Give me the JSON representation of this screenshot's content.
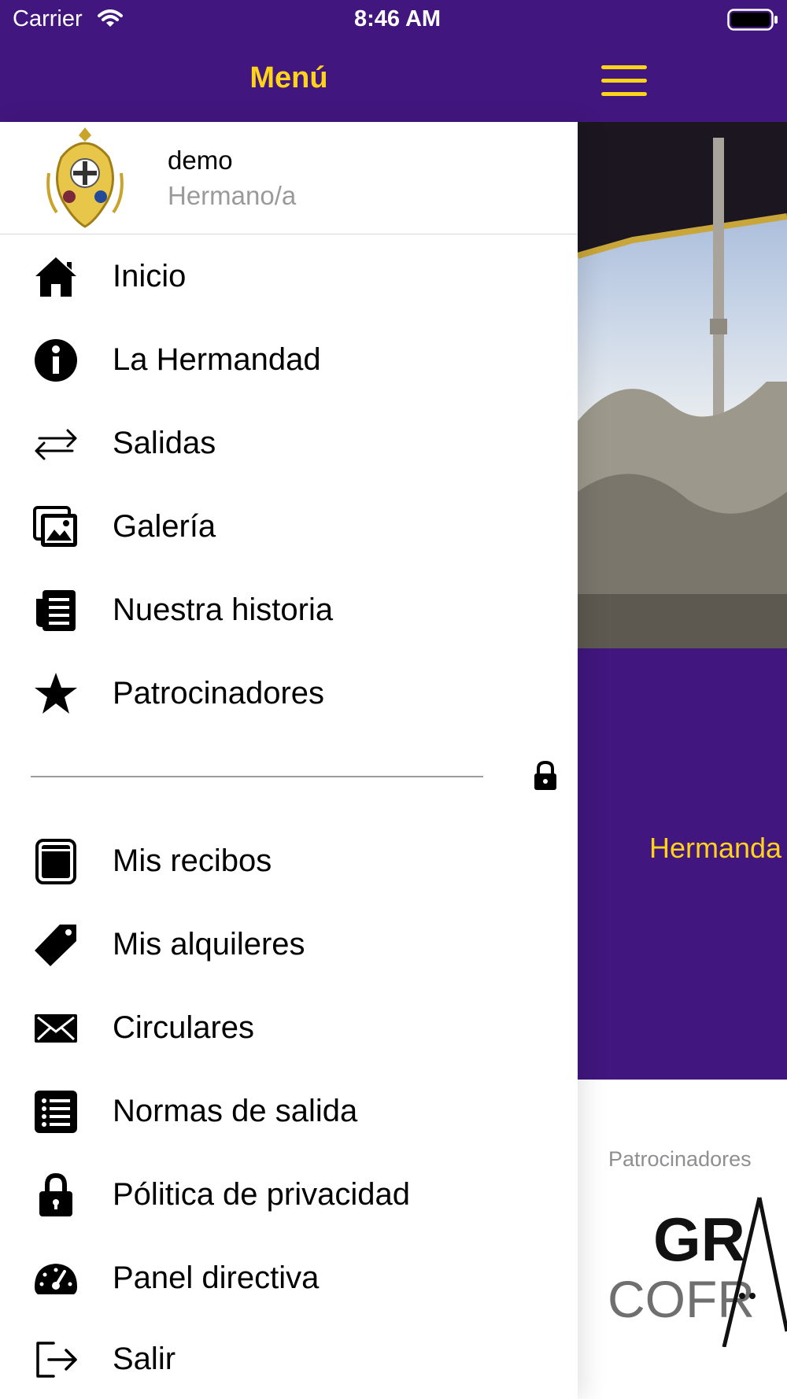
{
  "status_bar": {
    "carrier": "Carrier",
    "time": "8:46 AM"
  },
  "header": {
    "title": "Menú"
  },
  "profile": {
    "name": "demo",
    "role": "Hermano/a"
  },
  "menu_primary": [
    {
      "label": "Inicio",
      "icon": "home-icon"
    },
    {
      "label": "La Hermandad",
      "icon": "info-icon"
    },
    {
      "label": "Salidas",
      "icon": "arrows-exchange-icon"
    },
    {
      "label": "Galería",
      "icon": "gallery-icon"
    },
    {
      "label": "Nuestra historia",
      "icon": "document-icon"
    },
    {
      "label": "Patrocinadores",
      "icon": "star-icon"
    }
  ],
  "menu_private": [
    {
      "label": "Mis recibos",
      "icon": "receipt-icon"
    },
    {
      "label": "Mis alquileres",
      "icon": "tag-icon"
    },
    {
      "label": "Circulares",
      "icon": "envelope-icon"
    },
    {
      "label": "Normas de salida",
      "icon": "list-icon"
    },
    {
      "label": "Pólitica de privacidad",
      "icon": "lock-icon"
    },
    {
      "label": "Panel directiva",
      "icon": "speedometer-icon"
    },
    {
      "label": "Salir",
      "icon": "logout-icon"
    }
  ],
  "background": {
    "banner_text": "Hermanda",
    "sponsors_label": "Patrocinadores",
    "sponsor_logo": {
      "line1": "GR",
      "line2": "COFR"
    }
  },
  "colors": {
    "primary": "#41167e",
    "accent": "#ffd319",
    "text": "#000000",
    "secondary_text": "#9a9a9a"
  }
}
